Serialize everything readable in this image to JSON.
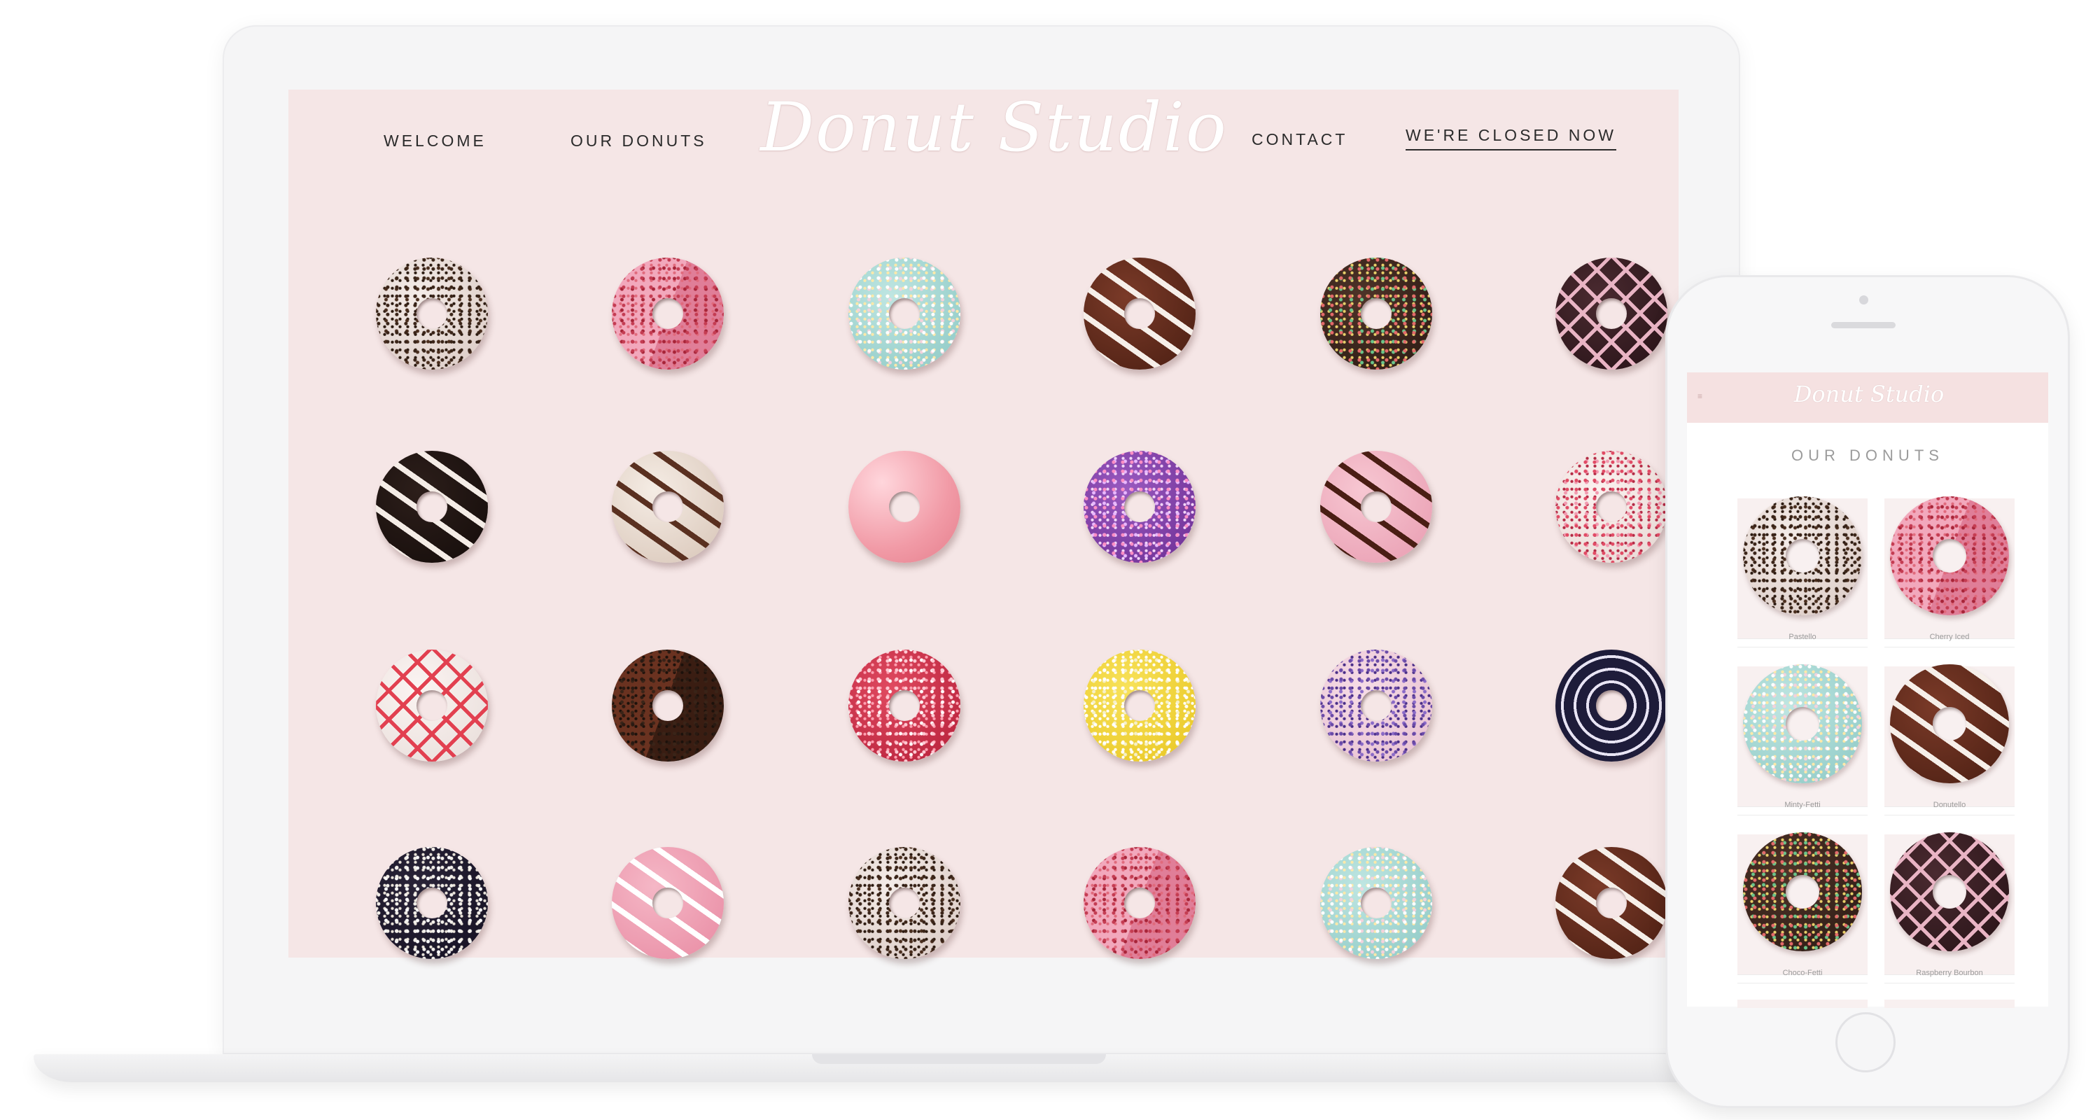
{
  "desktop": {
    "nav": {
      "welcome": "WELCOME",
      "our_donuts": "OUR DONUTS",
      "contact": "CONTACT",
      "closed": "WE'RE CLOSED NOW"
    },
    "logo": "Donut Studio",
    "background": "#f5e6e6"
  },
  "mobile": {
    "logo": "Donut Studio",
    "menu_icon": "hamburger-icon",
    "section_title": "OUR DONUTS",
    "donuts": [
      "Pastello",
      "Cherry Iced",
      "Minty-Fetti",
      "Donutello",
      "Choco-Fetti",
      "Raspberry Bourbon"
    ]
  }
}
